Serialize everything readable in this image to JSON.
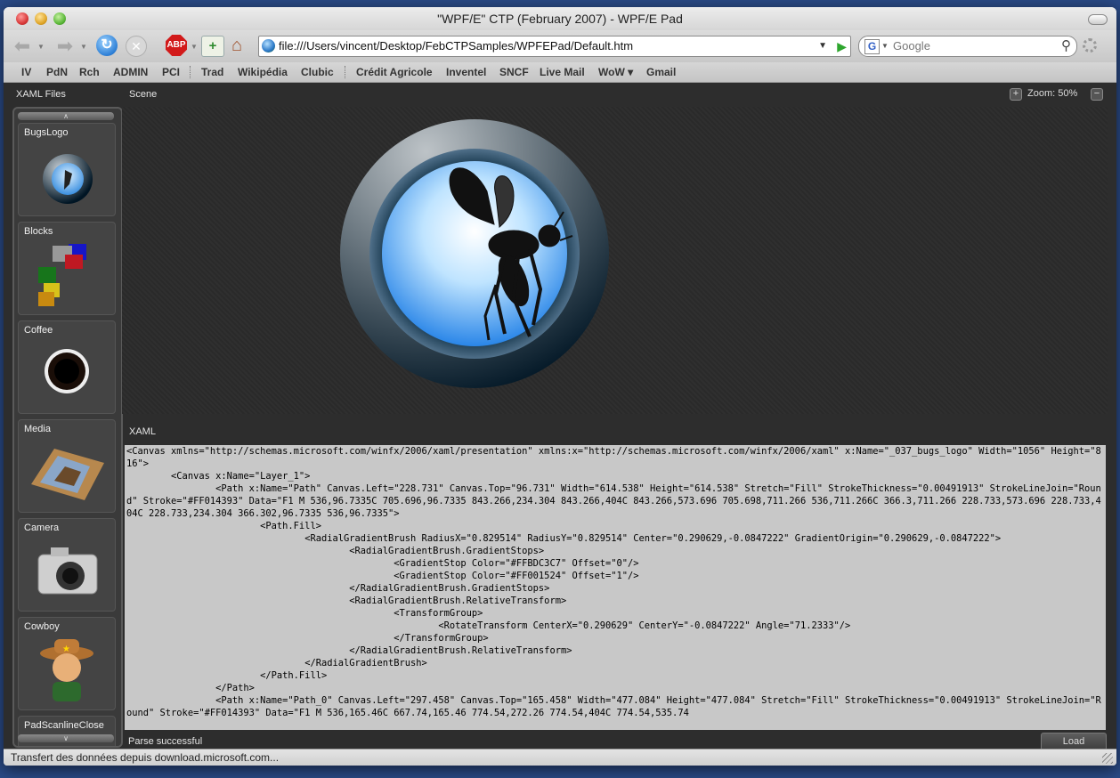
{
  "window": {
    "title": "\"WPF/E\" CTP (February 2007) - WPF/E Pad"
  },
  "toolbar": {
    "url": "file:///Users/vincent/Desktop/FebCTPSamples/WPFEPad/Default.htm",
    "search_placeholder": "Google",
    "abp_label": "ABP"
  },
  "bookmarks": [
    "IV",
    "PdN",
    "Rch",
    "ADMIN",
    "PCI",
    "Trad",
    "Wikipédia",
    "Clubic",
    "Crédit Agricole",
    "Inventel",
    "SNCF",
    "Live Mail",
    "WoW ▾",
    "Gmail"
  ],
  "sidebar": {
    "title": "XAML Files",
    "items": [
      {
        "label": "BugsLogo"
      },
      {
        "label": "Blocks"
      },
      {
        "label": "Coffee"
      },
      {
        "label": "Media"
      },
      {
        "label": "Camera"
      },
      {
        "label": "Cowboy"
      },
      {
        "label": "PadScanlineClose"
      }
    ]
  },
  "scene": {
    "title": "Scene",
    "zoom_label": "Zoom: 50%"
  },
  "xaml": {
    "title": "XAML",
    "code": "<Canvas xmlns=\"http://schemas.microsoft.com/winfx/2006/xaml/presentation\" xmlns:x=\"http://schemas.microsoft.com/winfx/2006/xaml\" x:Name=\"_037_bugs_logo\" Width=\"1056\" Height=\"816\">\n        <Canvas x:Name=\"Layer_1\">\n                <Path x:Name=\"Path\" Canvas.Left=\"228.731\" Canvas.Top=\"96.731\" Width=\"614.538\" Height=\"614.538\" Stretch=\"Fill\" StrokeThickness=\"0.00491913\" StrokeLineJoin=\"Round\" Stroke=\"#FF014393\" Data=\"F1 M 536,96.7335C 705.696,96.7335 843.266,234.304 843.266,404C 843.266,573.696 705.698,711.266 536,711.266C 366.3,711.266 228.733,573.696 228.733,404C 228.733,234.304 366.302,96.7335 536,96.7335\">\n                        <Path.Fill>\n                                <RadialGradientBrush RadiusX=\"0.829514\" RadiusY=\"0.829514\" Center=\"0.290629,-0.0847222\" GradientOrigin=\"0.290629,-0.0847222\">\n                                        <RadialGradientBrush.GradientStops>\n                                                <GradientStop Color=\"#FFBDC3C7\" Offset=\"0\"/>\n                                                <GradientStop Color=\"#FF001524\" Offset=\"1\"/>\n                                        </RadialGradientBrush.GradientStops>\n                                        <RadialGradientBrush.RelativeTransform>\n                                                <TransformGroup>\n                                                        <RotateTransform CenterX=\"0.290629\" CenterY=\"-0.0847222\" Angle=\"71.2333\"/>\n                                                </TransformGroup>\n                                        </RadialGradientBrush.RelativeTransform>\n                                </RadialGradientBrush>\n                        </Path.Fill>\n                </Path>\n                <Path x:Name=\"Path_0\" Canvas.Left=\"297.458\" Canvas.Top=\"165.458\" Width=\"477.084\" Height=\"477.084\" Stretch=\"Fill\" StrokeThickness=\"0.00491913\" StrokeLineJoin=\"Round\" Stroke=\"#FF014393\" Data=\"F1 M 536,165.46C 667.74,165.46 774.54,272.26 774.54,404C 774.54,535.74"
  },
  "status": {
    "parse": "Parse successful",
    "load_label": "Load",
    "bar": "Transfert des données depuis download.microsoft.com..."
  }
}
